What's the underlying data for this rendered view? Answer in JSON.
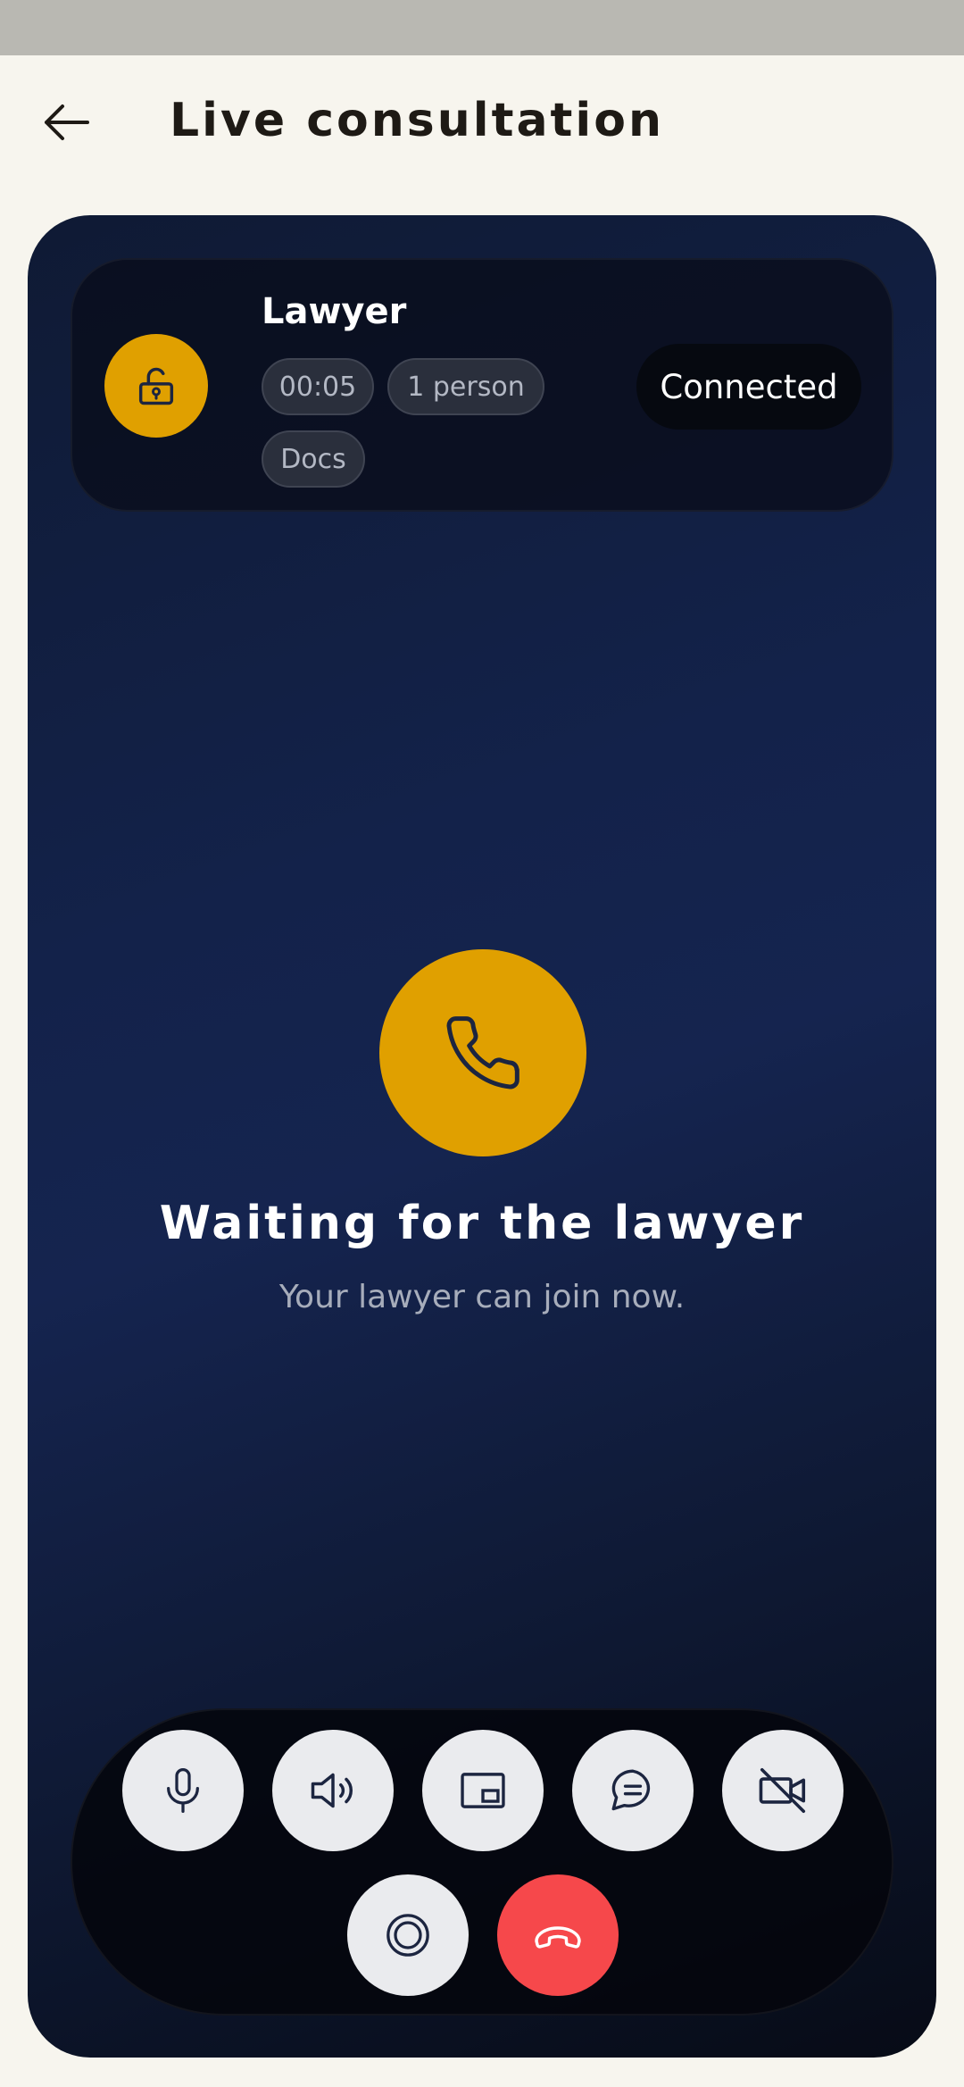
{
  "header": {
    "title": "Live consultation",
    "back_icon": "arrow-left-icon"
  },
  "call": {
    "participant_name": "Lawyer",
    "lock_icon": "unlock-icon",
    "chips": {
      "duration": "00:05",
      "participants": "1 person",
      "docs": "Docs"
    },
    "status": "Connected",
    "waiting_title": "Waiting for the lawyer",
    "waiting_subtitle": "Your lawyer can join now."
  },
  "controls": [
    {
      "name": "microphone",
      "icon": "microphone-icon"
    },
    {
      "name": "speaker",
      "icon": "speaker-icon"
    },
    {
      "name": "picture-in-picture",
      "icon": "picture-in-picture-icon"
    },
    {
      "name": "chat",
      "icon": "chat-icon"
    },
    {
      "name": "camera-off",
      "icon": "camera-off-icon"
    },
    {
      "name": "record",
      "icon": "record-icon"
    },
    {
      "name": "end-call",
      "icon": "end-call-icon"
    }
  ],
  "colors": {
    "accent": "#e0a000",
    "end_call": "#f6484b",
    "background": "#f7f5ee",
    "call_background": "#13224a"
  }
}
